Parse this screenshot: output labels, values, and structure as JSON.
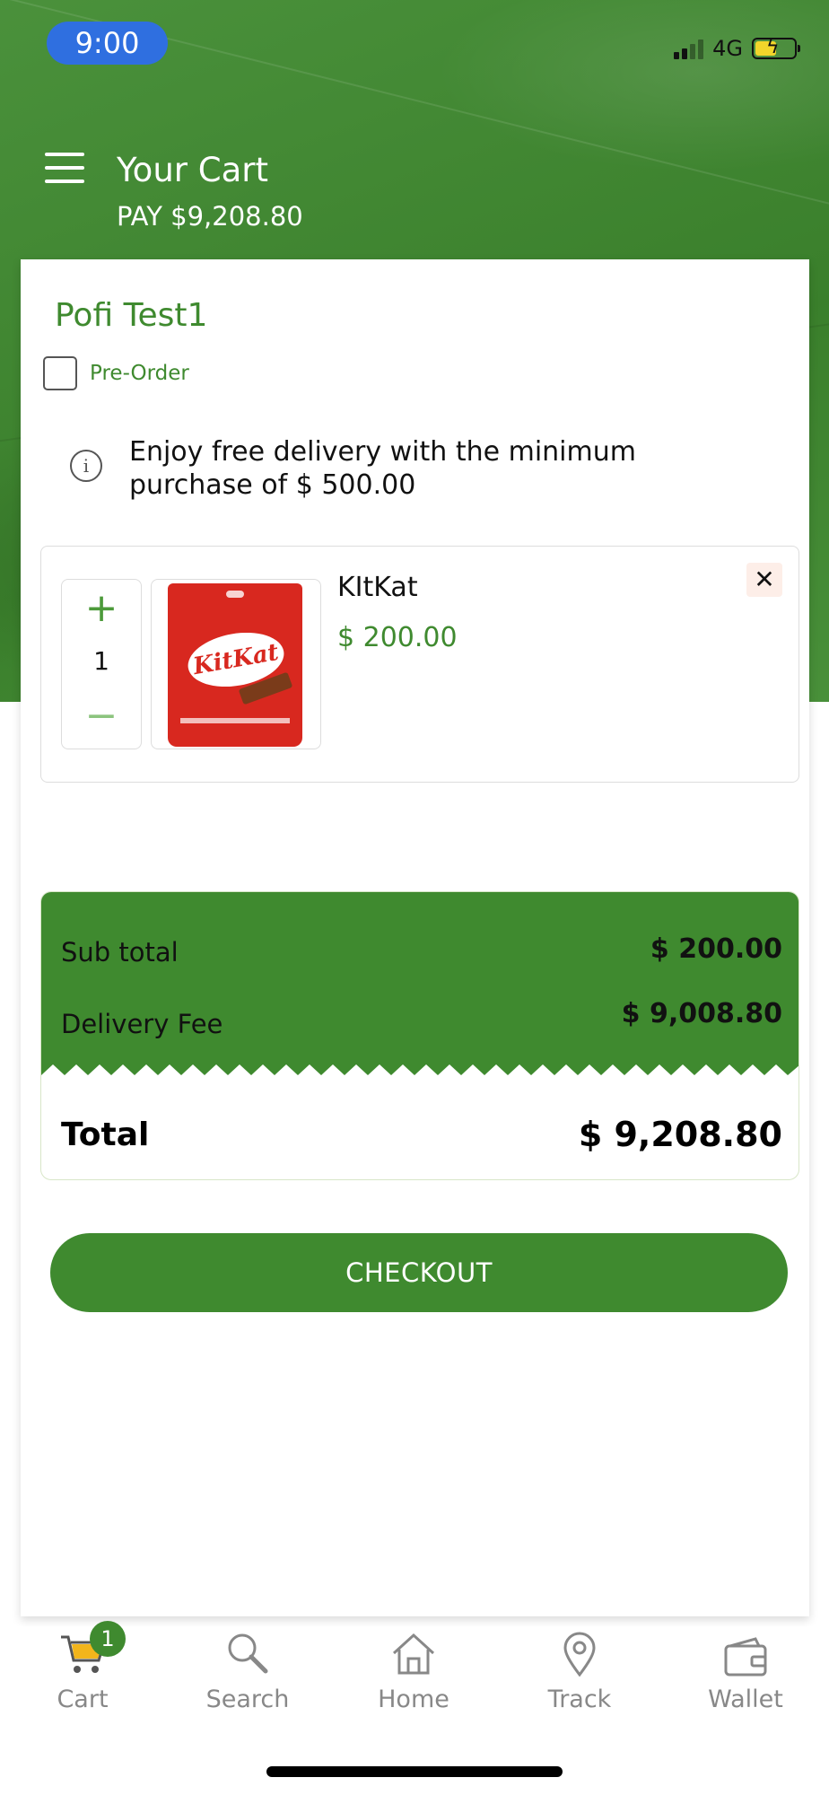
{
  "status_bar": {
    "time": "9:00",
    "network": "4G"
  },
  "header": {
    "title": "Your Cart",
    "pay": "PAY $9,208.80"
  },
  "store": {
    "name": "Pofi Test1",
    "preorder_label": "Pre-Order"
  },
  "notice": {
    "text": "Enjoy free delivery with the minimum purchase of  $ 500.00"
  },
  "item": {
    "name": "KItKat",
    "price": "$ 200.00",
    "quantity": "1",
    "plus": "+",
    "minus": "−",
    "remove": "✕",
    "image_text": "KitKat"
  },
  "summary": {
    "subtotal_label": "Sub total",
    "subtotal_value": "$ 200.00",
    "delivery_label": "Delivery Fee",
    "delivery_value": "$ 9,008.80",
    "total_label": "Total",
    "total_value": "$ 9,208.80"
  },
  "checkout_label": "CHECKOUT",
  "nav": {
    "items": [
      {
        "label": "Cart",
        "icon": "cart-icon",
        "badge": "1"
      },
      {
        "label": "Search",
        "icon": "search-icon"
      },
      {
        "label": "Home",
        "icon": "home-icon"
      },
      {
        "label": "Track",
        "icon": "location-pin-icon"
      },
      {
        "label": "Wallet",
        "icon": "wallet-icon"
      }
    ]
  },
  "colors": {
    "brand_green": "#3f8a2f",
    "status_pill": "#2f6fe0"
  }
}
